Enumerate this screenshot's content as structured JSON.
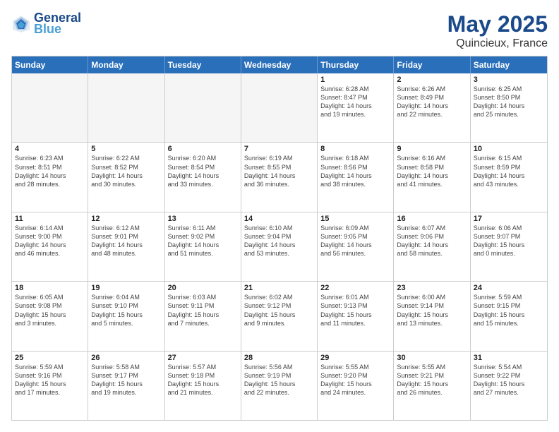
{
  "header": {
    "logo_line1": "General",
    "logo_line2": "Blue",
    "month": "May 2025",
    "location": "Quincieux, France"
  },
  "day_names": [
    "Sunday",
    "Monday",
    "Tuesday",
    "Wednesday",
    "Thursday",
    "Friday",
    "Saturday"
  ],
  "rows": [
    [
      {
        "day": "",
        "empty": true
      },
      {
        "day": "",
        "empty": true
      },
      {
        "day": "",
        "empty": true
      },
      {
        "day": "",
        "empty": true
      },
      {
        "day": "1",
        "sunrise": "6:28 AM",
        "sunset": "8:47 PM",
        "daylight": "14 hours and 19 minutes."
      },
      {
        "day": "2",
        "sunrise": "6:26 AM",
        "sunset": "8:49 PM",
        "daylight": "14 hours and 22 minutes."
      },
      {
        "day": "3",
        "sunrise": "6:25 AM",
        "sunset": "8:50 PM",
        "daylight": "14 hours and 25 minutes."
      }
    ],
    [
      {
        "day": "4",
        "sunrise": "6:23 AM",
        "sunset": "8:51 PM",
        "daylight": "14 hours and 28 minutes."
      },
      {
        "day": "5",
        "sunrise": "6:22 AM",
        "sunset": "8:52 PM",
        "daylight": "14 hours and 30 minutes."
      },
      {
        "day": "6",
        "sunrise": "6:20 AM",
        "sunset": "8:54 PM",
        "daylight": "14 hours and 33 minutes."
      },
      {
        "day": "7",
        "sunrise": "6:19 AM",
        "sunset": "8:55 PM",
        "daylight": "14 hours and 36 minutes."
      },
      {
        "day": "8",
        "sunrise": "6:18 AM",
        "sunset": "8:56 PM",
        "daylight": "14 hours and 38 minutes."
      },
      {
        "day": "9",
        "sunrise": "6:16 AM",
        "sunset": "8:58 PM",
        "daylight": "14 hours and 41 minutes."
      },
      {
        "day": "10",
        "sunrise": "6:15 AM",
        "sunset": "8:59 PM",
        "daylight": "14 hours and 43 minutes."
      }
    ],
    [
      {
        "day": "11",
        "sunrise": "6:14 AM",
        "sunset": "9:00 PM",
        "daylight": "14 hours and 46 minutes."
      },
      {
        "day": "12",
        "sunrise": "6:12 AM",
        "sunset": "9:01 PM",
        "daylight": "14 hours and 48 minutes."
      },
      {
        "day": "13",
        "sunrise": "6:11 AM",
        "sunset": "9:02 PM",
        "daylight": "14 hours and 51 minutes."
      },
      {
        "day": "14",
        "sunrise": "6:10 AM",
        "sunset": "9:04 PM",
        "daylight": "14 hours and 53 minutes."
      },
      {
        "day": "15",
        "sunrise": "6:09 AM",
        "sunset": "9:05 PM",
        "daylight": "14 hours and 56 minutes."
      },
      {
        "day": "16",
        "sunrise": "6:07 AM",
        "sunset": "9:06 PM",
        "daylight": "14 hours and 58 minutes."
      },
      {
        "day": "17",
        "sunrise": "6:06 AM",
        "sunset": "9:07 PM",
        "daylight": "15 hours and 0 minutes."
      }
    ],
    [
      {
        "day": "18",
        "sunrise": "6:05 AM",
        "sunset": "9:08 PM",
        "daylight": "15 hours and 3 minutes."
      },
      {
        "day": "19",
        "sunrise": "6:04 AM",
        "sunset": "9:10 PM",
        "daylight": "15 hours and 5 minutes."
      },
      {
        "day": "20",
        "sunrise": "6:03 AM",
        "sunset": "9:11 PM",
        "daylight": "15 hours and 7 minutes."
      },
      {
        "day": "21",
        "sunrise": "6:02 AM",
        "sunset": "9:12 PM",
        "daylight": "15 hours and 9 minutes."
      },
      {
        "day": "22",
        "sunrise": "6:01 AM",
        "sunset": "9:13 PM",
        "daylight": "15 hours and 11 minutes."
      },
      {
        "day": "23",
        "sunrise": "6:00 AM",
        "sunset": "9:14 PM",
        "daylight": "15 hours and 13 minutes."
      },
      {
        "day": "24",
        "sunrise": "5:59 AM",
        "sunset": "9:15 PM",
        "daylight": "15 hours and 15 minutes."
      }
    ],
    [
      {
        "day": "25",
        "sunrise": "5:59 AM",
        "sunset": "9:16 PM",
        "daylight": "15 hours and 17 minutes."
      },
      {
        "day": "26",
        "sunrise": "5:58 AM",
        "sunset": "9:17 PM",
        "daylight": "15 hours and 19 minutes."
      },
      {
        "day": "27",
        "sunrise": "5:57 AM",
        "sunset": "9:18 PM",
        "daylight": "15 hours and 21 minutes."
      },
      {
        "day": "28",
        "sunrise": "5:56 AM",
        "sunset": "9:19 PM",
        "daylight": "15 hours and 22 minutes."
      },
      {
        "day": "29",
        "sunrise": "5:55 AM",
        "sunset": "9:20 PM",
        "daylight": "15 hours and 24 minutes."
      },
      {
        "day": "30",
        "sunrise": "5:55 AM",
        "sunset": "9:21 PM",
        "daylight": "15 hours and 26 minutes."
      },
      {
        "day": "31",
        "sunrise": "5:54 AM",
        "sunset": "9:22 PM",
        "daylight": "15 hours and 27 minutes."
      }
    ]
  ]
}
